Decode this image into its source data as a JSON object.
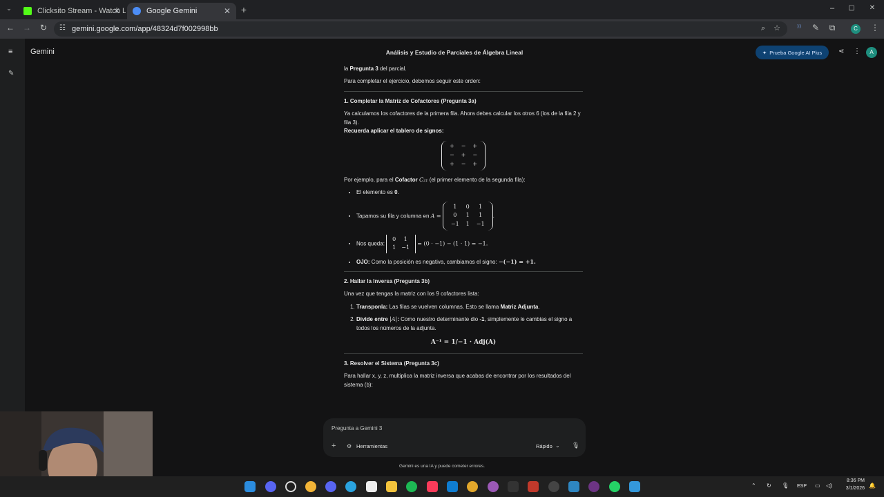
{
  "browser": {
    "tabs": [
      {
        "title": "Clicksito Stream - Watch Live o",
        "favicon_color": "#53fc18"
      },
      {
        "title": "Google Gemini",
        "favicon_color": "#4c8df6"
      }
    ],
    "new_tab": "+",
    "url": "gemini.google.com/app/48324d7f002998bb"
  },
  "app": {
    "brand": "Gemini",
    "chat_title": "Análisis y Estudio de Parciales de Álgebra Lineal",
    "upgrade_label": "Prueba Google AI Plus",
    "avatar": "A"
  },
  "content": {
    "intro_pre": "la ",
    "intro_bold": "Pregunta 3",
    "intro_post": " del parcial.",
    "order": "Para completar el ejercicio, debemos seguir este orden:",
    "s1_title": "1. Completar la Matriz de Cofactores (Pregunta 3a)",
    "s1_p": "Ya calculamos los cofactores de la primera fila. Ahora debes calcular los otros 6 (los de la fila 2 y fila 3).",
    "s1_bold": "Recuerda aplicar el tablero de signos:",
    "signs": [
      [
        "+",
        "−",
        "+"
      ],
      [
        "−",
        "+",
        "−"
      ],
      [
        "+",
        "−",
        "+"
      ]
    ],
    "ex_pre": "Por ejemplo, para el ",
    "ex_bold": "Cofactor ",
    "ex_math": "C₂₁",
    "ex_post": " (el primer elemento de la segunda fila):",
    "b1_pre": "El elemento es ",
    "b1_bold": "0",
    "b2": "Tapamos su fila y columna en ",
    "b2_math": "A =",
    "matA": [
      [
        "1",
        "0",
        "1"
      ],
      [
        "0",
        "1",
        "1"
      ],
      [
        "−1",
        "1",
        "−1"
      ]
    ],
    "b3": "Nos queda: ",
    "minor": [
      [
        "0",
        "1"
      ],
      [
        "1",
        "−1"
      ]
    ],
    "b3_math": "= (0 · −1) − (1 · 1) = −1.",
    "b4_bold": "OJO:",
    "b4": " Como la posición es negativa, cambiamos el signo: ",
    "b4_math": "−(−1) = +1.",
    "s2_title": "2. Hallar la Inversa (Pregunta 3b)",
    "s2_p": "Una vez que tengas la matriz con los 9 cofactores lista:",
    "o1_bold": "Transponla:",
    "o1": " Las filas se vuelven columnas. Esto se llama ",
    "o1_bold2": "Matriz Adjunta",
    "o2_bold": "Divide entre ",
    "o2_math": "|A|",
    "o2_colon": ":",
    "o2": " Como nuestro determinante dio ",
    "o2_bold2": "-1",
    "o2_post": ", simplemente le cambias el signo a todos los números de la adjunta.",
    "formula": "A⁻¹ = 1/−1 · Adj(A)",
    "s3_title": "3. Resolver el Sistema (Pregunta 3c)",
    "s3_p": "Para hallar x, y, z, multiplica la matriz inversa que acabas de encontrar por los resultados del sistema (b):"
  },
  "input": {
    "placeholder": "Pregunta a Gemini 3",
    "tools": "Herramientas",
    "mode": "Rápido"
  },
  "disclaimer": "Gemini es una IA y puede cometer errores.",
  "taskbar": {
    "lang": "ESP",
    "time": "8:36 PM",
    "date": "3/1/2026"
  }
}
